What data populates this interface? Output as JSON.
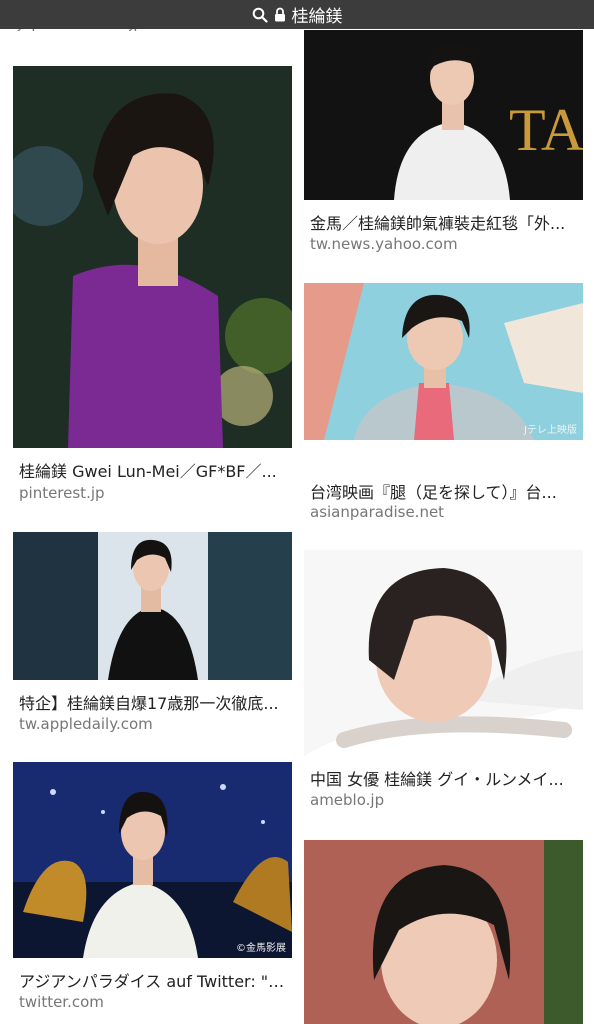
{
  "browser": {
    "url_text": "桂綸鎂",
    "search_icon": "search-icon",
    "lock_icon": "lock-icon",
    "bar_color": "#3c3c3c"
  },
  "clipped_source": "japanesociase.jp",
  "results": [
    {
      "title": "桂綸鎂 Gwei Lun-Mei／GF*BF／...",
      "source": "pinterest.jp",
      "overlay": ""
    },
    {
      "title": "金馬／桂綸鎂帥氣褲裝走紅毯「外...",
      "source": "tw.news.yahoo.com",
      "overlay": ""
    },
    {
      "title": "台湾映画『腿（足を探して）』台...",
      "source": "asianparadise.net",
      "overlay": "Jテレ上映版"
    },
    {
      "title": "特企】桂綸鎂自爆17歳那一次徹底...",
      "source": "tw.appledaily.com",
      "overlay": ""
    },
    {
      "title": "中国 女優 桂綸鎂 グイ・ルンメイ...",
      "source": "ameblo.jp",
      "overlay": ""
    },
    {
      "title": "アジアンパラダイス auf Twitter: \"#...",
      "source": "twitter.com",
      "overlay": "©金馬影展"
    },
    {
      "title": "",
      "source": "",
      "overlay": ""
    }
  ]
}
